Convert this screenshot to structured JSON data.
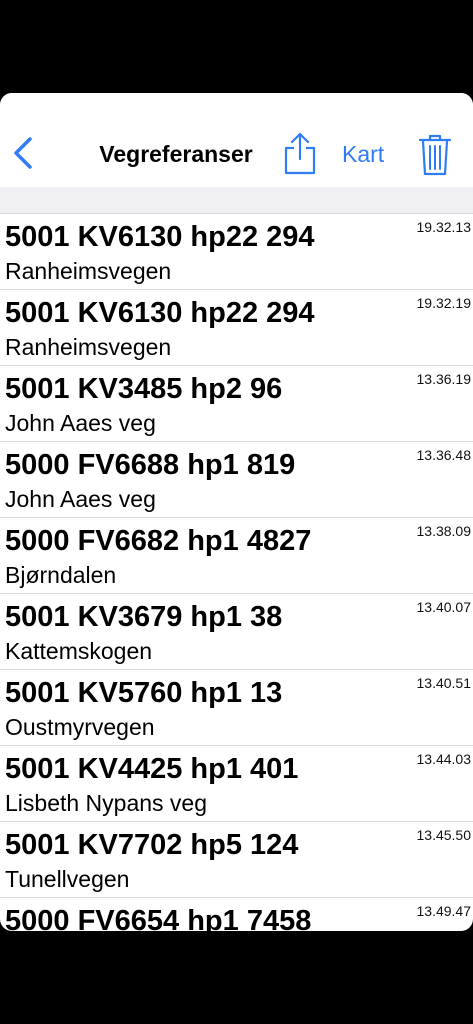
{
  "navbar": {
    "title": "Vegreferanser",
    "map_label": "Kart",
    "accent_color": "#2f7cf6",
    "icons": [
      "chevron-left-icon",
      "share-icon",
      "trash-icon"
    ]
  },
  "entries": [
    {
      "ref": "5001 KV6130 hp22 294",
      "street": "Ranheimsvegen",
      "time": "19.32.13"
    },
    {
      "ref": "5001 KV6130 hp22 294",
      "street": "Ranheimsvegen",
      "time": "19.32.19"
    },
    {
      "ref": "5001 KV3485 hp2 96",
      "street": "John Aaes veg",
      "time": "13.36.19"
    },
    {
      "ref": "5000 FV6688 hp1 819",
      "street": "John Aaes veg",
      "time": "13.36.48"
    },
    {
      "ref": "5000 FV6682 hp1 4827",
      "street": "Bjørndalen",
      "time": "13.38.09"
    },
    {
      "ref": "5001 KV3679 hp1 38",
      "street": "Kattemskogen",
      "time": "13.40.07"
    },
    {
      "ref": "5001 KV5760 hp1 13",
      "street": "Oustmyrvegen",
      "time": "13.40.51"
    },
    {
      "ref": "5001 KV4425 hp1 401",
      "street": "Lisbeth Nypans veg",
      "time": "13.44.03"
    },
    {
      "ref": "5001 KV7702 hp5 124",
      "street": "Tunellvegen",
      "time": "13.45.50"
    },
    {
      "ref": "5000 FV6654 hp1 7458",
      "street": "",
      "time": "13.49.47"
    }
  ]
}
